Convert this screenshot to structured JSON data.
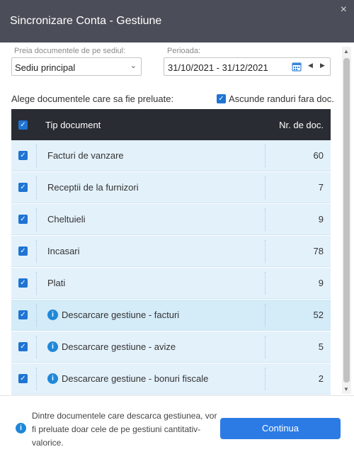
{
  "window": {
    "title": "Sincronizare Conta - Gestiune",
    "close_glyph": "×"
  },
  "filters": {
    "sediu_label": "Preia documentele de pe sediul:",
    "sediu_value": "Sediu principal",
    "perioada_label": "Perioada:",
    "perioada_value": "31/10/2021 - 31/12/2021"
  },
  "intro_text": "Alege documentele care sa fie preluate:",
  "hide_empty_label": "Ascunde randuri fara doc.",
  "hide_empty_checked": true,
  "table": {
    "col_type": "Tip document",
    "col_count": "Nr. de doc.",
    "rows": [
      {
        "label": "Facturi de vanzare",
        "count": "60",
        "info": false,
        "checked": true
      },
      {
        "label": "Receptii de la furnizori",
        "count": "7",
        "info": false,
        "checked": true
      },
      {
        "label": "Cheltuieli",
        "count": "9",
        "info": false,
        "checked": true
      },
      {
        "label": "Incasari",
        "count": "78",
        "info": false,
        "checked": true
      },
      {
        "label": "Plati",
        "count": "9",
        "info": false,
        "checked": true
      },
      {
        "label": "Descarcare gestiune - facturi",
        "count": "52",
        "info": true,
        "checked": true
      },
      {
        "label": "Descarcare gestiune - avize",
        "count": "5",
        "info": true,
        "checked": true
      },
      {
        "label": "Descarcare gestiune - bonuri fiscale",
        "count": "2",
        "info": true,
        "checked": true
      }
    ]
  },
  "footer": {
    "note": "Dintre documentele care descarca gestiunea, vor fi preluate doar cele de pe gestiuni cantitativ-valorice.",
    "button": "Continua"
  },
  "colors": {
    "titlebar": "#4b4e58",
    "table_header": "#2a2c33",
    "row_bg": "#e3f1fb",
    "row_highlight": "#d4ebf8",
    "accent": "#2c7be5",
    "checkbox": "#1f74d4"
  },
  "icons": {
    "checkbox": "checkbox-checked-icon",
    "calendar": "calendar-icon",
    "info": "info-icon",
    "dropdown": "chevron-down-icon"
  }
}
